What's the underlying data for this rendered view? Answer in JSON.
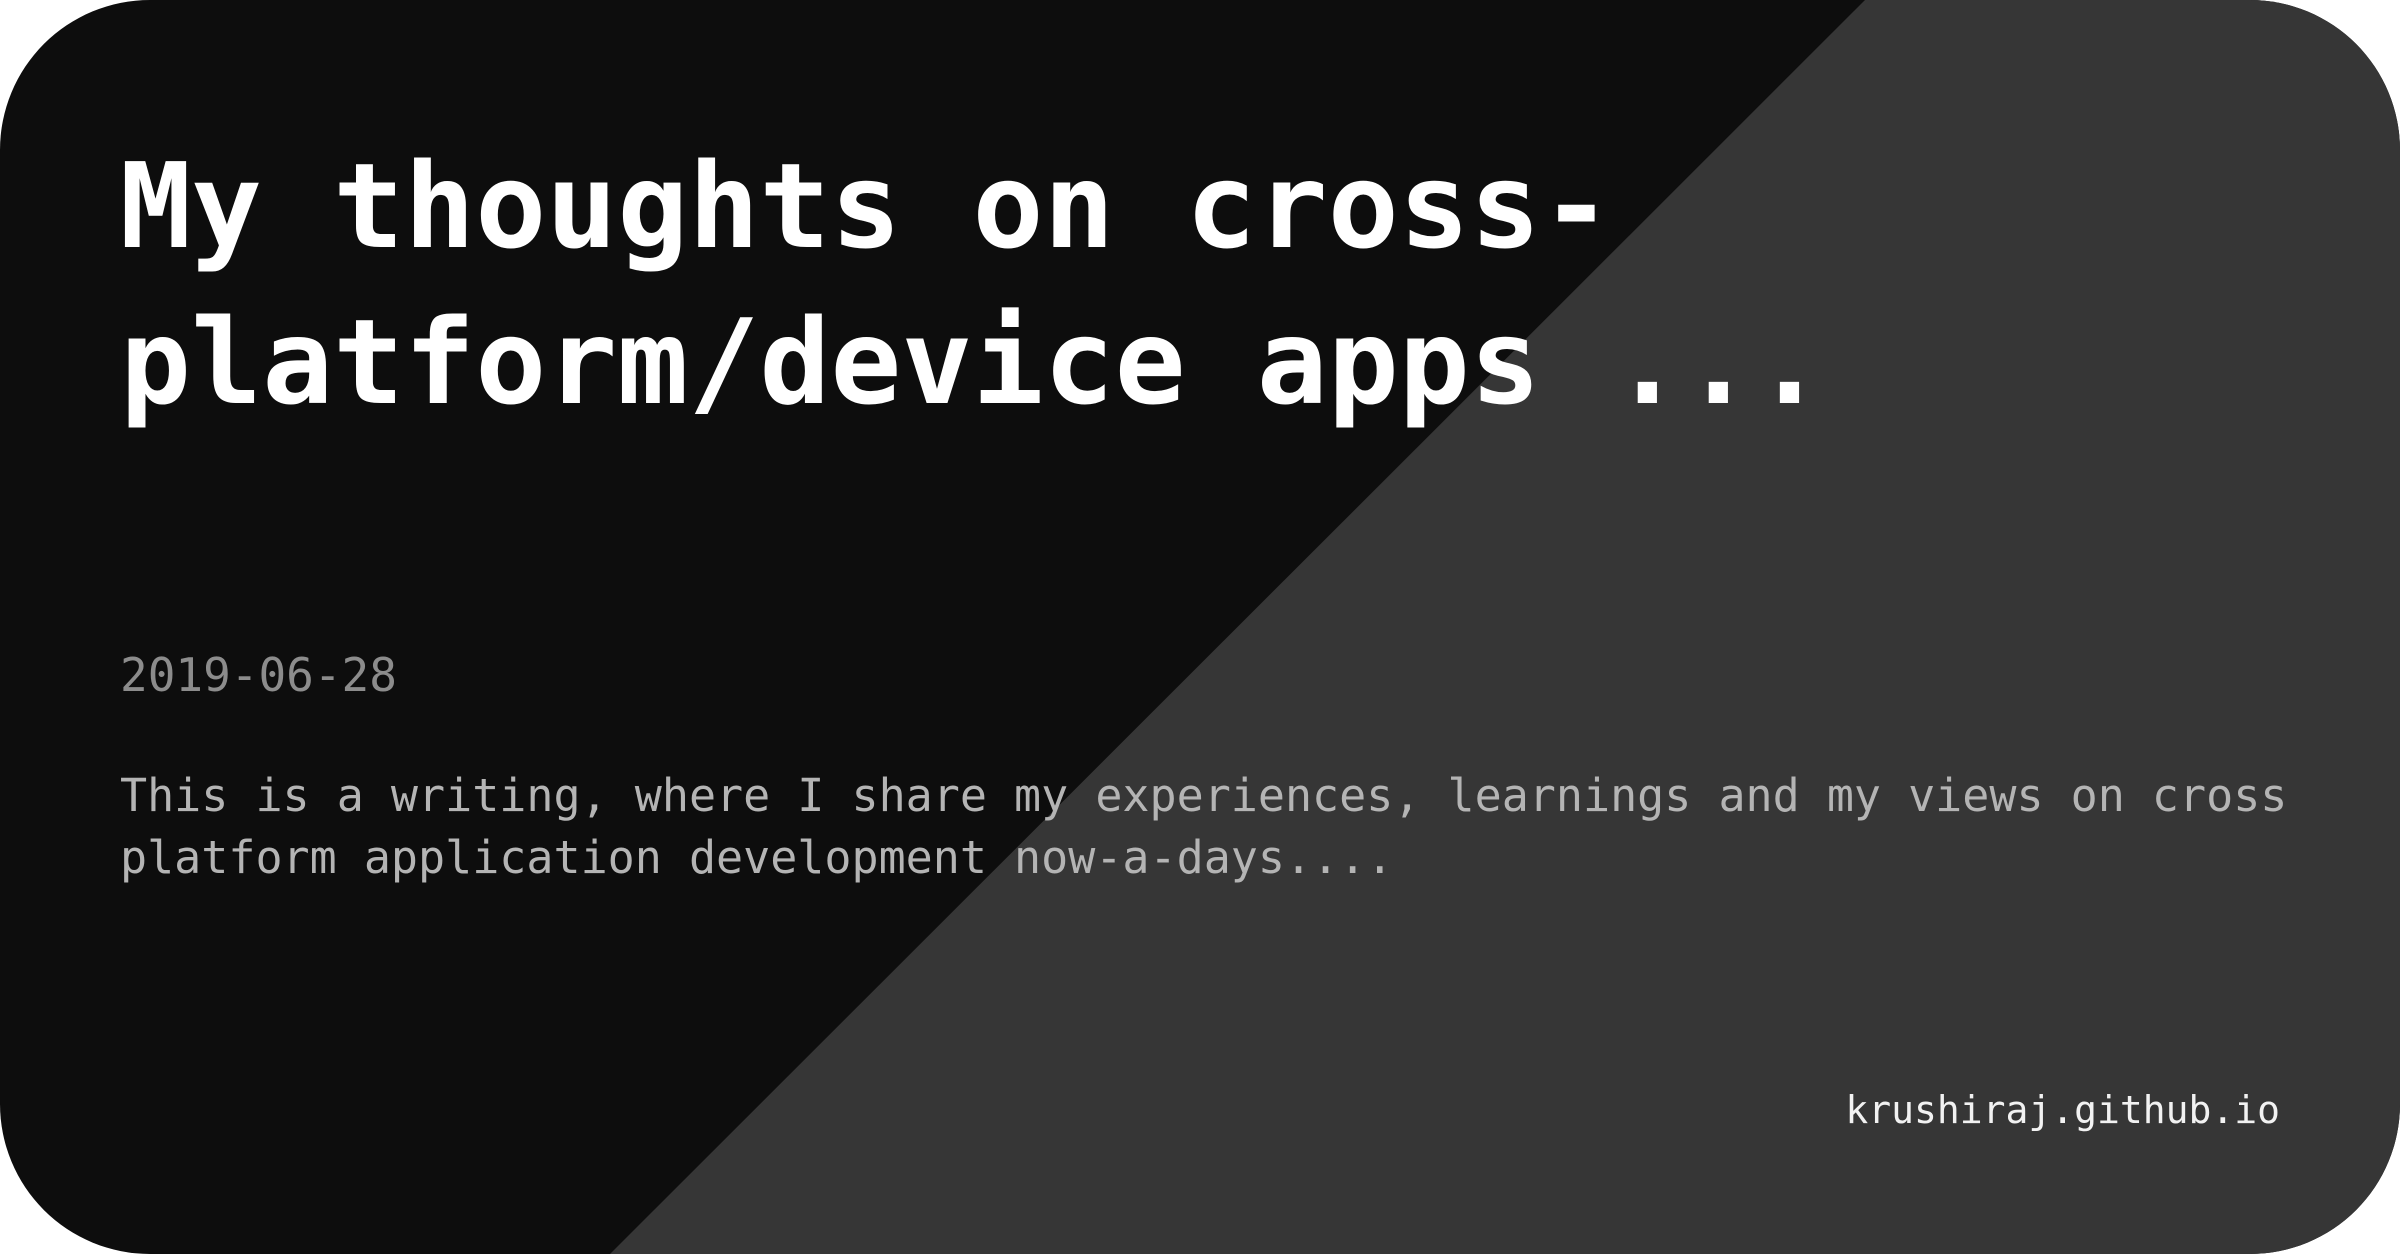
{
  "card": {
    "title": "My thoughts on cross-platform/device apps ...",
    "date": "2019-06-28",
    "summary": "This is a writing, where I share my experiences, learnings and my views on cross platform application development now-a-days....",
    "site": "krushiraj.github.io"
  },
  "colors": {
    "dark_background": "#0d0d0d",
    "light_background": "#363636",
    "title_text": "#ffffff",
    "date_text": "#8c8c8c",
    "summary_text": "#b4b4b4",
    "site_text": "#f2f2f2"
  }
}
